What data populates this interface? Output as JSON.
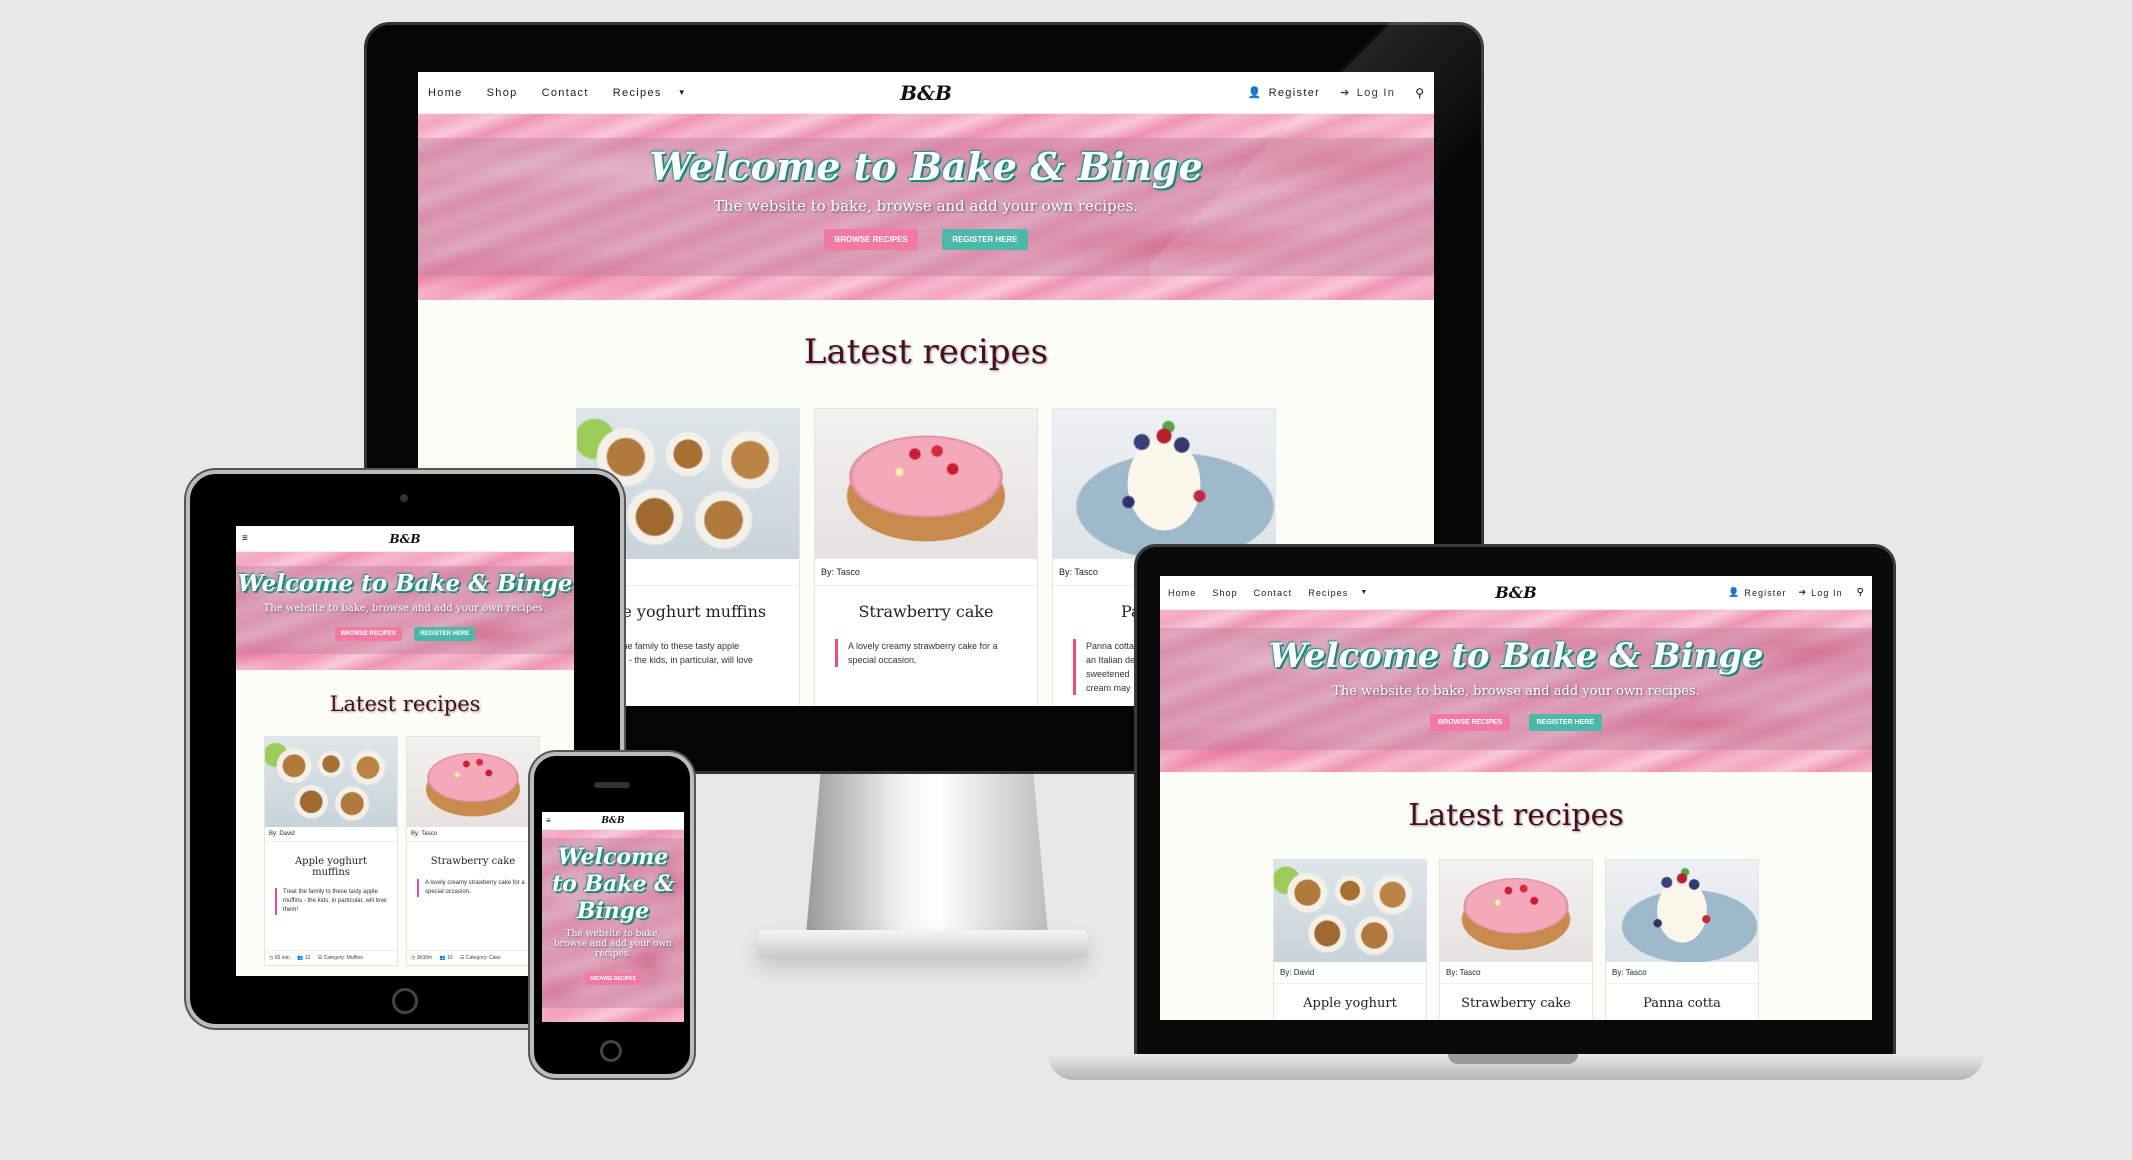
{
  "brand": "B&B",
  "nav": {
    "home": "Home",
    "shop": "Shop",
    "contact": "Contact",
    "recipes": "Recipes",
    "register": "Register",
    "login": "Log In"
  },
  "hero": {
    "title": "Welcome to Bake & Binge",
    "subtitle": "The website to bake, browse and add your own recipes.",
    "browse_button": "BROWSE RECIPES",
    "register_button": "REGISTER HERE"
  },
  "latest_heading": "Latest recipes",
  "recipes": [
    {
      "author": "By: David",
      "title": "Apple yoghurt muffins",
      "description": "Treat the family to these tasty apple muffins - the kids, in particular, will love them!",
      "time": "55 min",
      "servings": "12",
      "category": "Category: Muffins"
    },
    {
      "author": "By: Tasco",
      "title": "Strawberry cake",
      "description": "A lovely creamy strawberry cake for a special occasion.",
      "time": "3h30m",
      "servings": "16",
      "category": "Category: Cake"
    },
    {
      "author": "By: Tasco",
      "title": "Panna cotta",
      "description": "Panna cotta is an Italian dessert of sweetened cream may be",
      "time": "",
      "servings": "",
      "category": ""
    }
  ],
  "monitor_partial": {
    "muffin_title": "ple yoghurt muffins",
    "muffin_desc_lines": [
      "at the family to these tasty apple",
      "ffins - the kids, in particular, will love",
      "m!"
    ],
    "panna_title": "Pa",
    "panna_desc_lines": [
      "Panna cotta",
      "an Italian de",
      "sweetened",
      "cream may"
    ]
  },
  "laptop_partial": {
    "titles": [
      "Apple yoghurt",
      "Strawberry cake",
      "Panna cotta"
    ]
  },
  "icons": {
    "dropdown": "caret-down-icon",
    "register": "user-plus-icon",
    "login": "sign-in-icon",
    "search": "search-icon",
    "menu": "hamburger-menu-icon"
  },
  "colors": {
    "pink_button": "#f279a2",
    "teal_button": "#4bb8a9",
    "heading": "#4a0c1e",
    "accent_border": "#e94f7a"
  }
}
